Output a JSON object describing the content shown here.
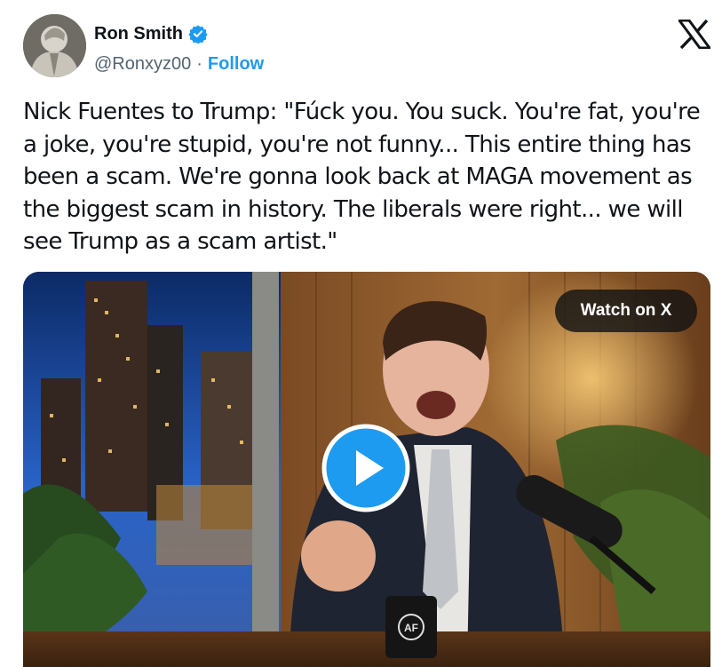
{
  "author": {
    "name": "Ron Smith",
    "handle": "@Ronxyz00",
    "separator": "·",
    "follow_label": "Follow",
    "verified": true
  },
  "icons": {
    "verified": "verified-badge-icon",
    "brand": "x-logo-icon",
    "play": "play-icon"
  },
  "colors": {
    "accent": "#1d9bf0",
    "text": "#0f1419",
    "secondary": "#536471"
  },
  "tweet": {
    "text": "Nick Fuentes to Trump: \"Fúck you. You suck. You're fat, you're a joke, you're stupid, you're not funny... This entire thing has been a scam. We're gonna look back at MAGA movement as the biggest scam in history. The liberals were right... we will see Trump as a scam artist.\""
  },
  "media": {
    "watch_label": "Watch on X",
    "mug_logo": "AF"
  }
}
